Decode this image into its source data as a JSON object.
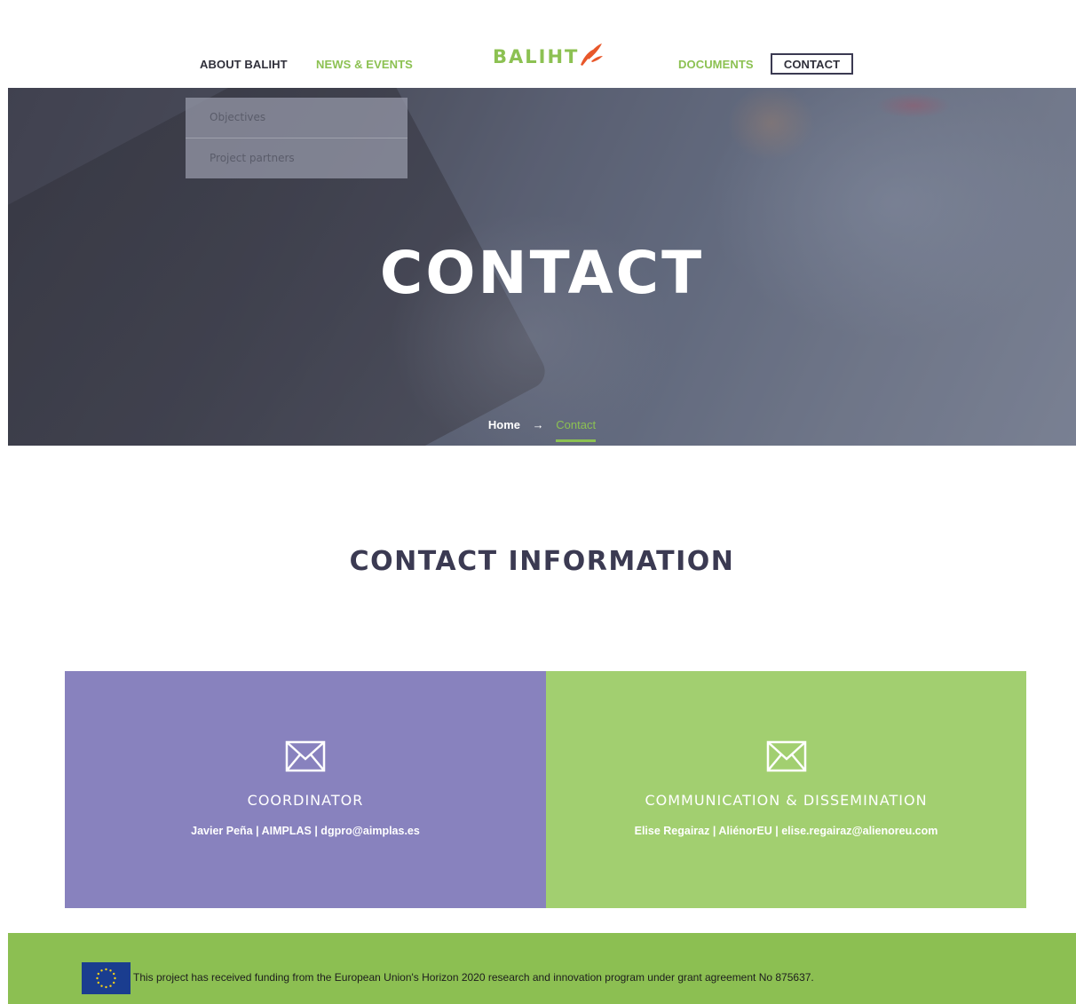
{
  "header": {
    "nav_left": [
      "ABOUT BALIHT",
      "NEWS & EVENTS"
    ],
    "nav_right": [
      "DOCUMENTS",
      "CONTACT"
    ],
    "logo_text": "BALIHT"
  },
  "dropdown": {
    "items": [
      "Objectives",
      "Project partners"
    ]
  },
  "hero": {
    "title": "CONTACT",
    "breadcrumb": {
      "home": "Home",
      "arrow": "→",
      "current": "Contact"
    }
  },
  "contact": {
    "title": "CONTACT INFORMATION",
    "cards": [
      {
        "title": "COORDINATOR",
        "text": "Javier Peña | AIMPLAS | dgpro@aimplas.es",
        "icon": "mail-icon",
        "color": "#8882be"
      },
      {
        "title": "COMMUNICATION & DISSEMINATION",
        "text": "Elise Regairaz | AliénorEU | elise.regairaz@alienoreu.com",
        "icon": "mail-icon",
        "color": "#a2cf70"
      }
    ]
  },
  "footer": {
    "text": "This project has received funding from the European Union's Horizon 2020 research and innovation program under grant agreement No 875637.",
    "flag_icon": "eu-flag-icon"
  },
  "colors": {
    "brand_green": "#8cc152",
    "brand_dark": "#3b3a52"
  }
}
